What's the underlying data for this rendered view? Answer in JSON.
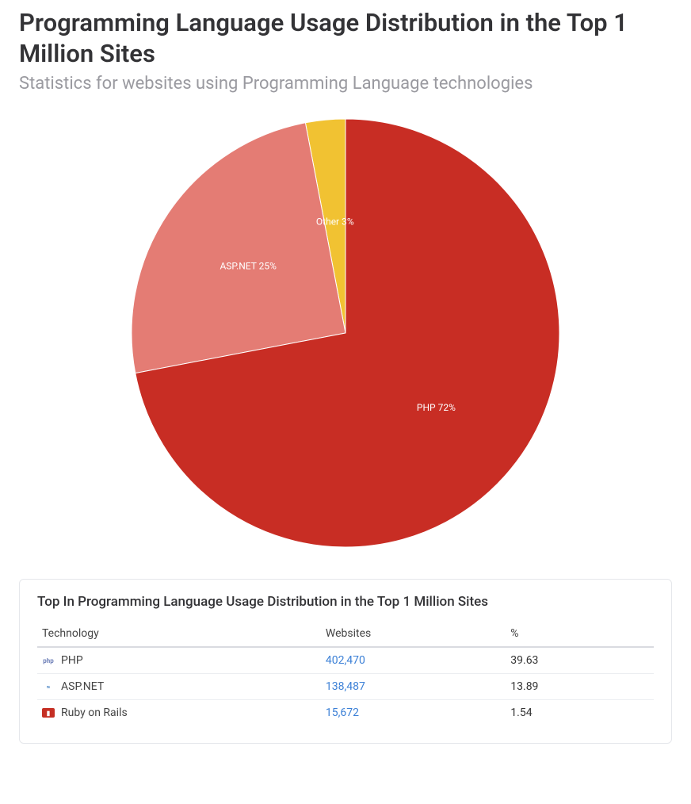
{
  "header": {
    "title": "Programming Language Usage Distribution in the Top 1 Million Sites",
    "subtitle": "Statistics for websites using Programming Language technologies"
  },
  "chart_data": {
    "type": "pie",
    "title": "",
    "slices": [
      {
        "name": "PHP",
        "value": 72,
        "label": "PHP 72%",
        "color": "#c82d24"
      },
      {
        "name": "ASP.NET",
        "value": 25,
        "label": "ASP.NET 25%",
        "color": "#e47c74"
      },
      {
        "name": "Other",
        "value": 3,
        "label": "Other 3%",
        "color": "#f1c232"
      }
    ]
  },
  "table": {
    "panel_title": "Top In Programming Language Usage Distribution in the Top 1 Million Sites",
    "columns": {
      "technology": "Technology",
      "websites": "Websites",
      "percent": "%"
    },
    "rows": [
      {
        "icon": "php",
        "technology": "PHP",
        "websites": "402,470",
        "percent": "39.63"
      },
      {
        "icon": "aspnet",
        "technology": "ASP.NET",
        "websites": "138,487",
        "percent": "13.89"
      },
      {
        "icon": "ror",
        "technology": "Ruby on Rails",
        "websites": "15,672",
        "percent": "1.54"
      }
    ]
  }
}
